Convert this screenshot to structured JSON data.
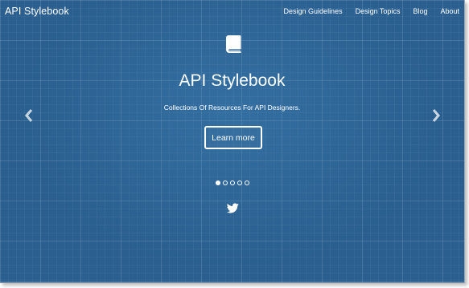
{
  "navbar": {
    "brand": "API Stylebook",
    "links": [
      {
        "label": "Design Guidelines"
      },
      {
        "label": "Design Topics"
      },
      {
        "label": "Blog"
      },
      {
        "label": "About"
      }
    ]
  },
  "hero": {
    "icon": "book-icon",
    "title": "API Stylebook",
    "subtitle": "Collections Of Resources For API Designers.",
    "button_label": "Learn more"
  },
  "carousel": {
    "prev_icon": "chevron-left-icon",
    "next_icon": "chevron-right-icon",
    "slide_count": 5,
    "active_slide": 1
  },
  "social": {
    "icon": "twitter-icon"
  },
  "colors": {
    "background": "#2a5f8f",
    "text": "#ffffff"
  }
}
